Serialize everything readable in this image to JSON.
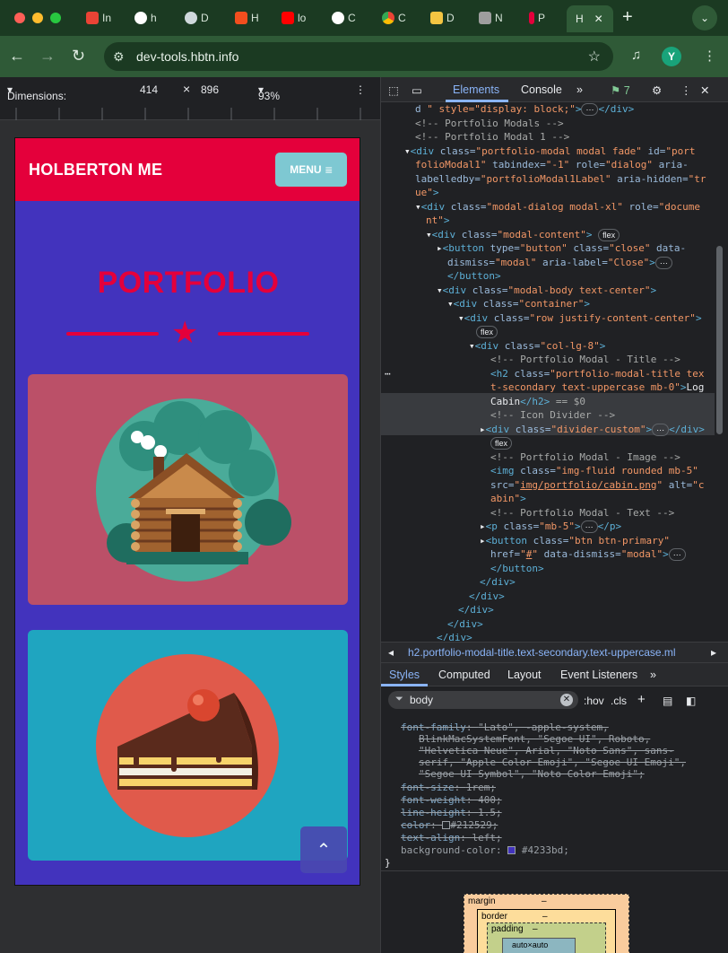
{
  "browser": {
    "tabs": [
      {
        "label": "In",
        "icon": "gmail-icon",
        "color": "#ea4335"
      },
      {
        "label": "h",
        "icon": "github-icon",
        "color": "#ffffff"
      },
      {
        "label": "D",
        "icon": "globe-icon",
        "color": "#cfd8dc"
      },
      {
        "label": "H",
        "icon": "figma-icon",
        "color": "#f24e1e"
      },
      {
        "label": "lo",
        "icon": "youtube-icon",
        "color": "#ff0000"
      },
      {
        "label": "C",
        "icon": "openai-icon",
        "color": "#ffffff"
      },
      {
        "label": "C",
        "icon": "chrome-icon",
        "color": "#fbbc05"
      },
      {
        "label": "D",
        "icon": "udemy-icon",
        "color": "#f4c542"
      },
      {
        "label": "N",
        "icon": "book-icon",
        "color": "#9e9e9e"
      },
      {
        "label": "P",
        "icon": "holberton-icon",
        "color": "#e4003b"
      }
    ],
    "active_tab": {
      "label": "H",
      "close": "✕"
    },
    "new_tab": "+",
    "url": "dev-tools.hbtn.info",
    "avatar_letter": "Y"
  },
  "device_toolbar": {
    "dimensions": "Dimensions: iPho...",
    "width": "414",
    "times": "×",
    "height": "896",
    "zoom": "93%"
  },
  "site": {
    "brand": "HOLBERTON ME",
    "menu_label": "MENU",
    "section_title": "PORTFOLIO",
    "colors": {
      "primary": "#e4003b",
      "background": "#4233bd",
      "menu": "#7ec8d2",
      "card1": "#bb5068",
      "card2": "#1fa5c0"
    },
    "cards": [
      {
        "image": "cabin-image"
      },
      {
        "image": "cake-image"
      }
    ],
    "scroll_top_glyph": "⌃"
  },
  "devtools": {
    "tabs": [
      "Elements",
      "Console"
    ],
    "more": "»",
    "issues_count": "7",
    "breadcrumb": "h2.portfolio-modal-title.text-secondary.text-uppercase.ml",
    "styles_tabs": [
      "Styles",
      "Computed",
      "Layout",
      "Event Listeners"
    ],
    "filter_value": "body",
    "filter_tools": [
      ":hov",
      ".cls"
    ],
    "style_rules": [
      {
        "prop": "font-family",
        "value": "\"Lato\", -apple-system,",
        "struck": true
      },
      {
        "prop": "",
        "value": "BlinkMacSystemFont, \"Segoe UI\", Roboto,",
        "struck": true
      },
      {
        "prop": "",
        "value": "\"Helvetica Neue\", Arial, \"Noto Sans\", sans-",
        "struck": true
      },
      {
        "prop": "",
        "value": "serif, \"Apple Color Emoji\", \"Segoe UI Emoji\",",
        "struck": true
      },
      {
        "prop": "",
        "value": "\"Segoe UI Symbol\", \"Noto Color Emoji\";",
        "struck": true
      },
      {
        "prop": "font-size",
        "value": "1rem;",
        "struck": true
      },
      {
        "prop": "font-weight",
        "value": "400;",
        "struck": true
      },
      {
        "prop": "line-height",
        "value": "1.5;",
        "struck": true
      },
      {
        "prop": "color",
        "value": "#212529;",
        "struck": true,
        "swatch": "#212529"
      },
      {
        "prop": "text-align",
        "value": "left;",
        "struck": true
      },
      {
        "prop": "background-color",
        "value": "#4233bd;",
        "struck": false,
        "swatch": "#4233bd"
      }
    ],
    "rule_close": "}",
    "box_model": {
      "margin": "margin",
      "border": "border",
      "padding": "padding",
      "content": "auto×auto",
      "dash": "–"
    }
  }
}
